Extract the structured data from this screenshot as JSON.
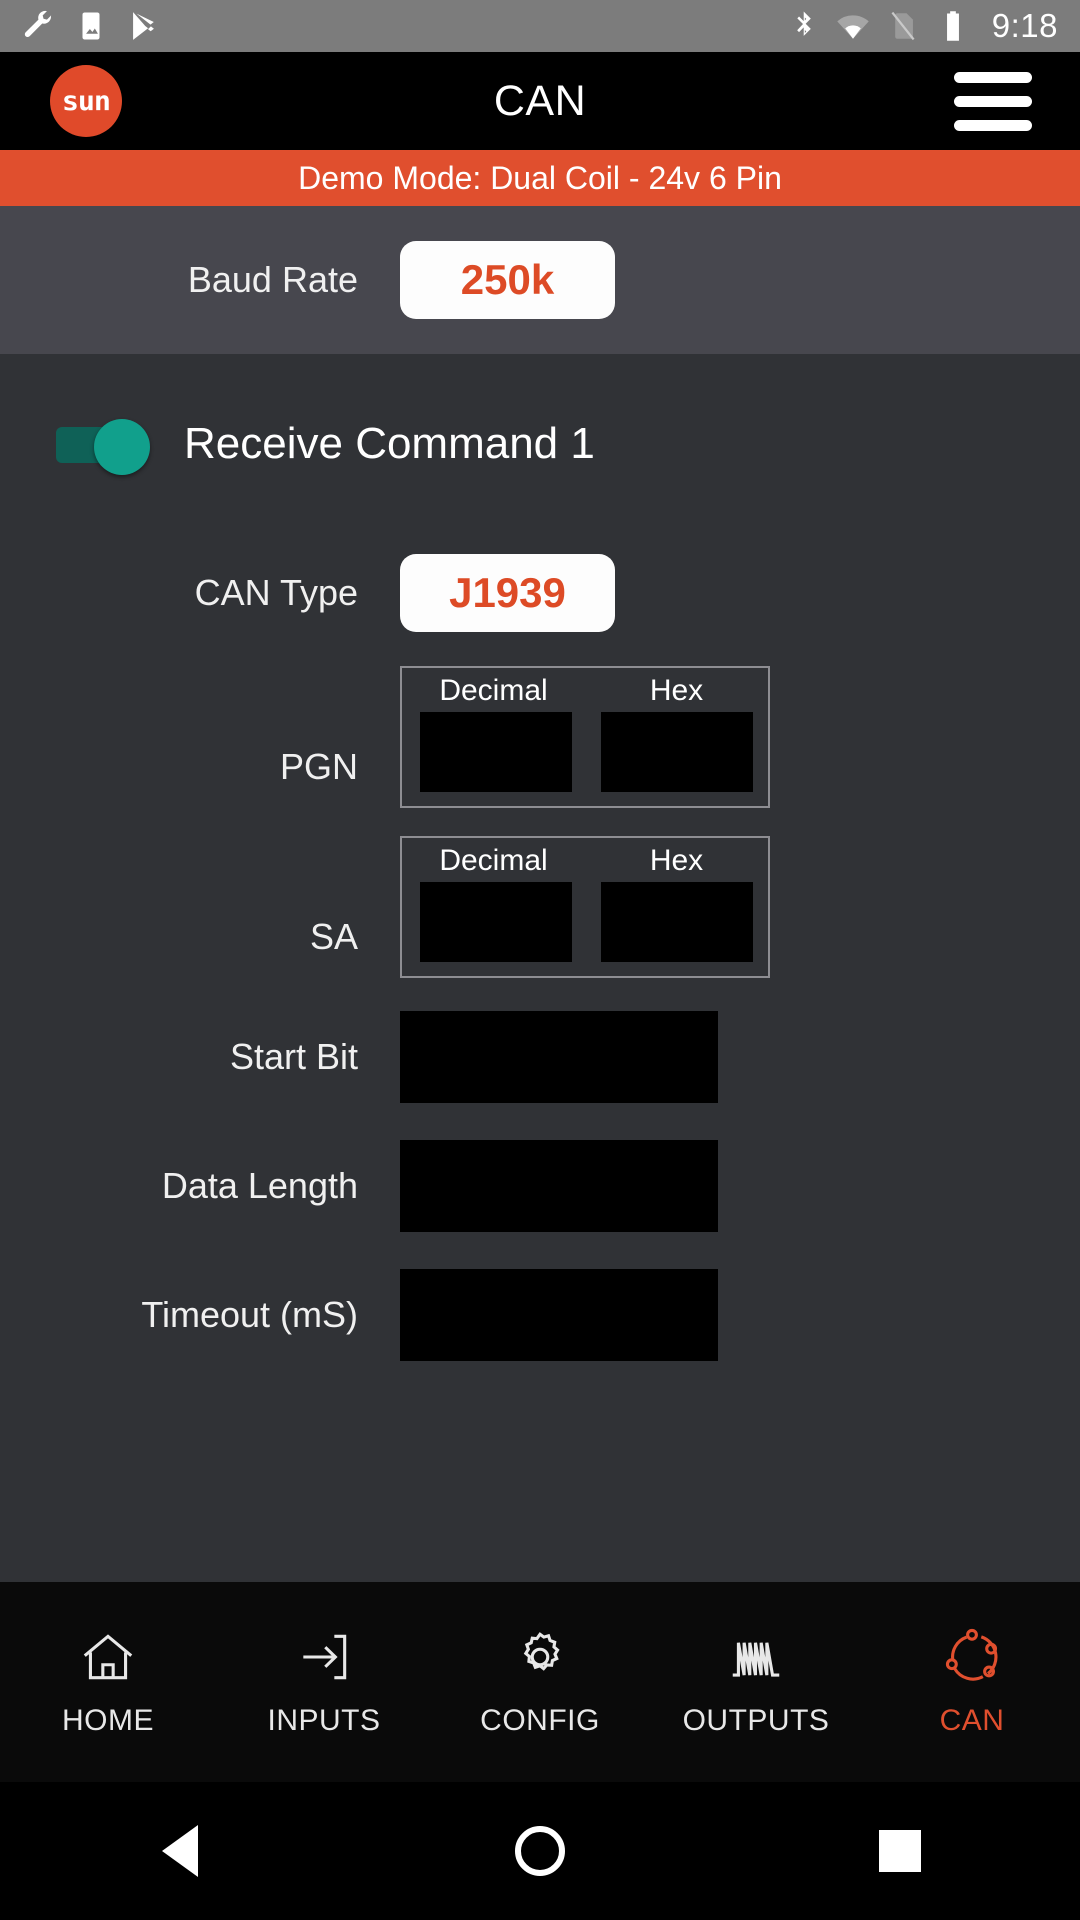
{
  "status_bar": {
    "icons_left": [
      "wrench-icon",
      "image-icon",
      "play-store-icon"
    ],
    "icons_right": [
      "bluetooth-icon",
      "wifi-icon",
      "no-sim-icon",
      "battery-icon"
    ],
    "clock": "9:18"
  },
  "app_bar": {
    "logo_text": "sun",
    "title": "CAN",
    "menu_icon": "hamburger-menu-icon"
  },
  "demo_banner": {
    "text": "Demo Mode: Dual Coil - 24v 6 Pin",
    "color": "#e04f2e"
  },
  "baud": {
    "label": "Baud Rate",
    "value": "250k"
  },
  "command": {
    "title": "Receive Command 1",
    "toggle_state": "on",
    "toggle_color": "#11a08c",
    "can_type": {
      "label": "CAN Type",
      "value": "J1939"
    },
    "pgn": {
      "label": "PGN",
      "columns": [
        "Decimal",
        "Hex"
      ],
      "values": [
        "",
        ""
      ]
    },
    "sa": {
      "label": "SA",
      "columns": [
        "Decimal",
        "Hex"
      ],
      "values": [
        "",
        ""
      ]
    },
    "fields": [
      {
        "label": "Start Bit",
        "value": ""
      },
      {
        "label": "Data Length",
        "value": ""
      },
      {
        "label": "Timeout (mS)",
        "value": ""
      }
    ]
  },
  "bottom_nav": {
    "active": "CAN",
    "accent": "#e04f2e",
    "items": [
      {
        "label": "HOME",
        "icon": "home-icon"
      },
      {
        "label": "INPUTS",
        "icon": "arrow-into-box-icon"
      },
      {
        "label": "CONFIG",
        "icon": "gear-icon"
      },
      {
        "label": "OUTPUTS",
        "icon": "waveform-icon"
      },
      {
        "label": "CAN",
        "icon": "can-network-icon"
      }
    ]
  },
  "system_nav": {
    "back": "back-triangle-icon",
    "home": "home-circle-icon",
    "recents": "recents-square-icon"
  }
}
